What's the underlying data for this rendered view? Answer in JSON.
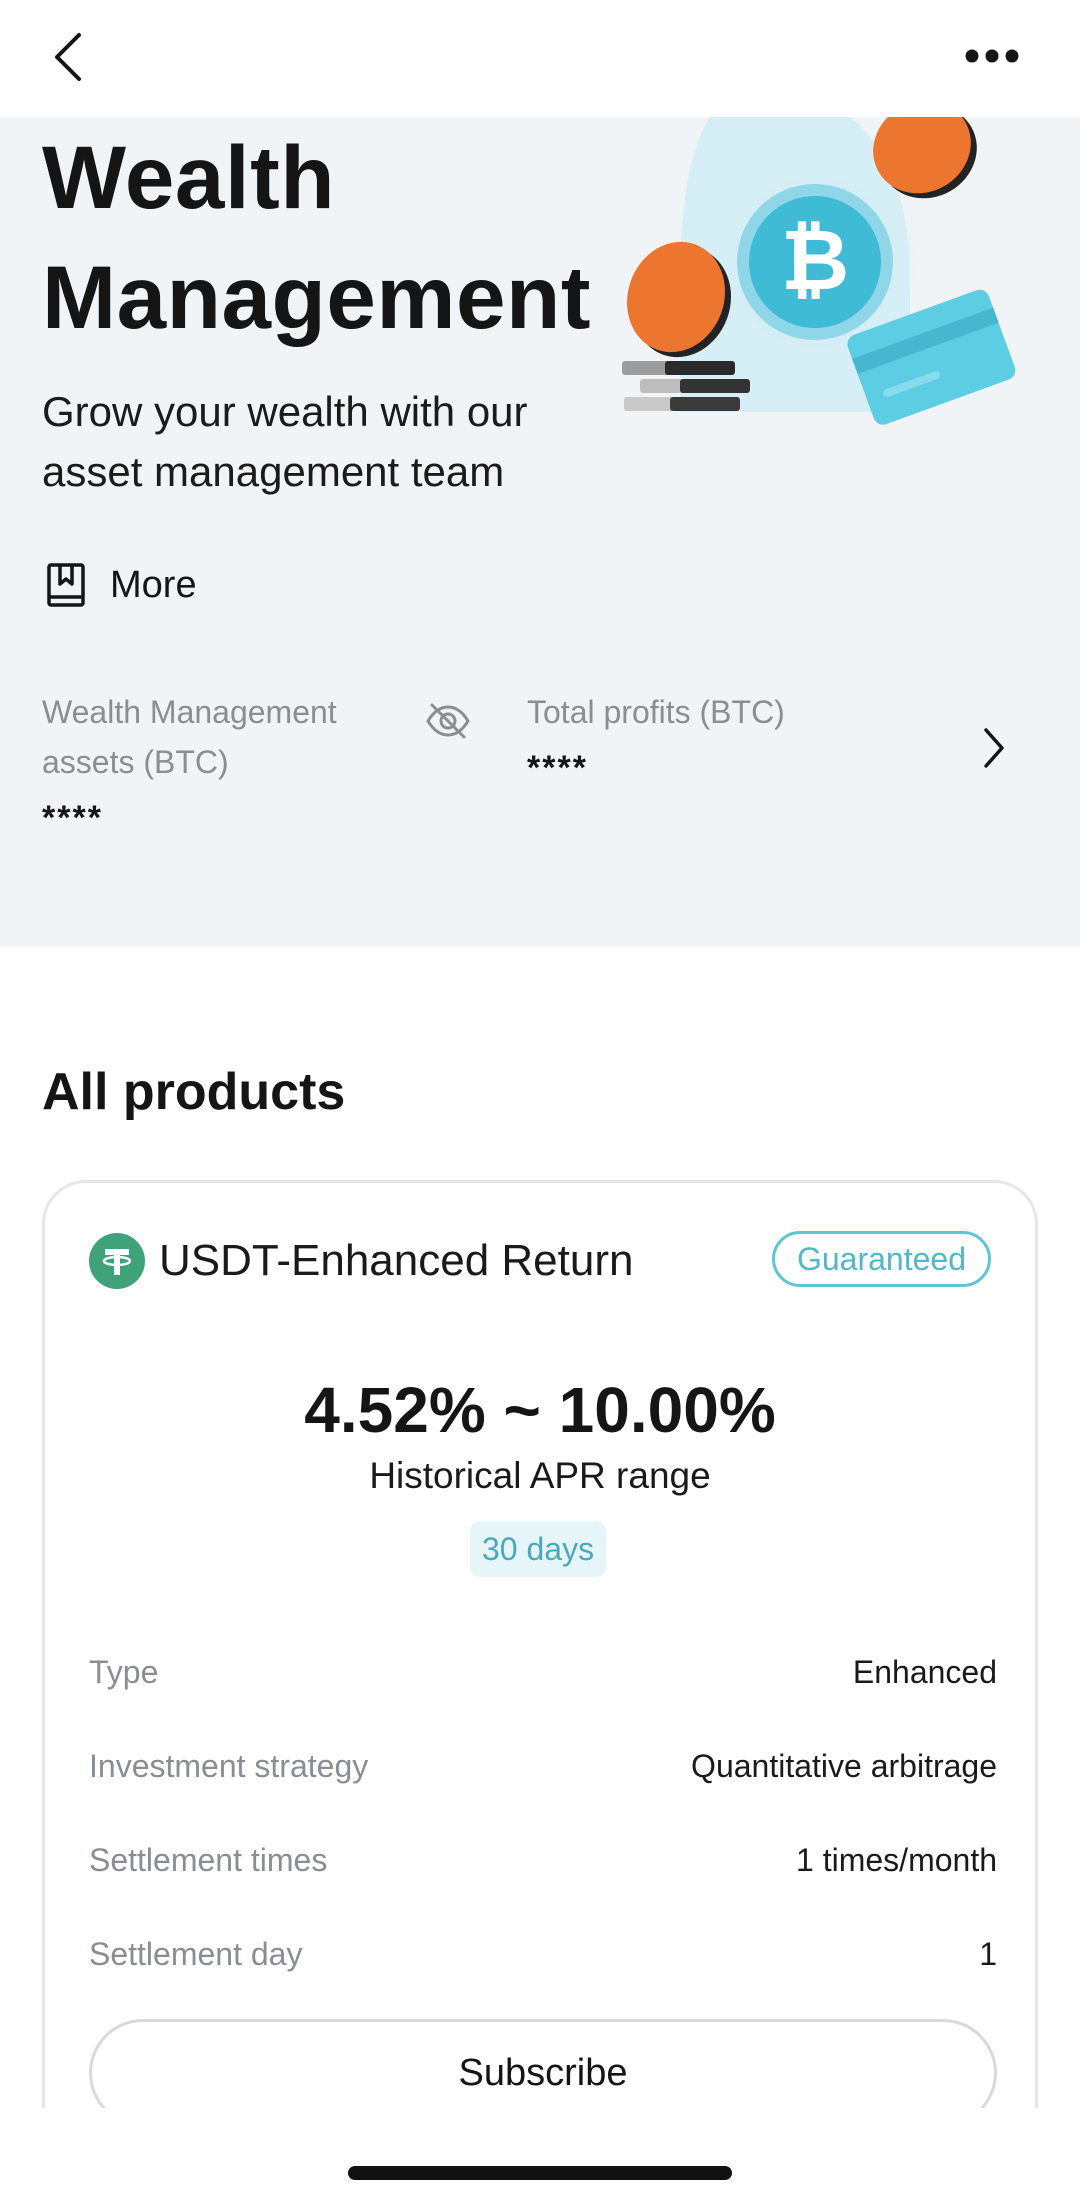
{
  "header": {
    "back_icon": "chevron-left-icon",
    "more_icon": "ellipsis-icon"
  },
  "hero": {
    "title_line1": "Wealth",
    "title_line2": "Management",
    "subtitle_line1": "Grow your wealth with our",
    "subtitle_line2": "asset management team",
    "more_label": "More",
    "more_icon": "book-icon"
  },
  "stats": {
    "assets_label_line1": "Wealth Management",
    "assets_label_line2": "assets (BTC)",
    "assets_value": "****",
    "profits_label": "Total profits (BTC)",
    "profits_value": "****",
    "hide_icon": "eye-off-icon"
  },
  "products": {
    "section_title": "All products",
    "items": [
      {
        "name": "USDT-Enhanced Return",
        "coin_icon": "tether-icon",
        "badge": "Guaranteed",
        "apr_range": "4.52% ~ 10.00%",
        "apr_label": "Historical APR range",
        "term": "30 days",
        "details": [
          {
            "label": "Type",
            "value": "Enhanced"
          },
          {
            "label": "Investment strategy",
            "value": "Quantitative arbitrage"
          },
          {
            "label": "Settlement times",
            "value": "1 times/month"
          },
          {
            "label": "Settlement day",
            "value": "1"
          }
        ],
        "action_label": "Subscribe"
      }
    ]
  },
  "colors": {
    "hero_bg": "#f1f4f6",
    "accent_teal": "#4fb8c9",
    "coin_green": "#3fa37a",
    "orange": "#ee7a30",
    "btc_blue": "#3fbbd6"
  }
}
